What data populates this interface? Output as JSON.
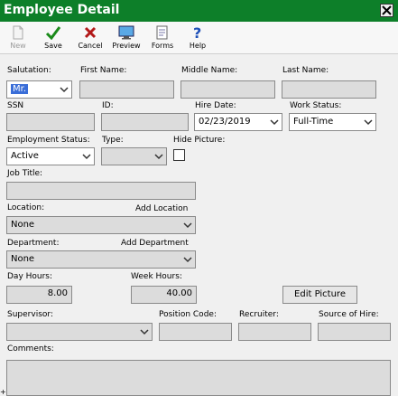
{
  "window": {
    "title": "Employee Detail",
    "close_label": "X"
  },
  "toolbar": {
    "new_label": "New",
    "save_label": "Save",
    "cancel_label": "Cancel",
    "preview_label": "Preview",
    "forms_label": "Forms",
    "help_label": "Help"
  },
  "labels": {
    "salutation": "Salutation:",
    "first_name": "First Name:",
    "middle_name": "Middle Name:",
    "last_name": "Last Name:",
    "ssn": "SSN",
    "id": "ID:",
    "hire_date": "Hire Date:",
    "work_status": "Work Status:",
    "employment_status": "Employment Status:",
    "type": "Type:",
    "hide_picture": "Hide Picture:",
    "job_title": "Job Title:",
    "location": "Location:",
    "add_location": "Add Location",
    "department": "Department:",
    "add_department": "Add Department",
    "day_hours": "Day Hours:",
    "week_hours": "Week Hours:",
    "supervisor": "Supervisor:",
    "position_code": "Position Code:",
    "recruiter": "Recruiter:",
    "source_of_hire": "Source of Hire:",
    "comments": "Comments:"
  },
  "fields": {
    "salutation": "Mr.",
    "first_name": "",
    "middle_name": "",
    "last_name": "",
    "ssn": "",
    "id": "",
    "hire_date": "02/23/2019",
    "work_status": "Full-Time",
    "employment_status": "Active",
    "type": "",
    "hide_picture": false,
    "job_title": "",
    "location": "None",
    "department": "None",
    "day_hours": "8.00",
    "week_hours": "40.00",
    "supervisor": "",
    "position_code": "",
    "recruiter": "",
    "source_of_hire": "",
    "comments": ""
  },
  "buttons": {
    "edit_picture": "Edit Picture"
  },
  "bottom_mark": "+",
  "colors": {
    "titlebar": "#0d7f29",
    "field_bg": "#dcdcdc",
    "selection": "#3a6ed8"
  },
  "icons": {
    "new": "new-doc-icon",
    "save": "checkmark-icon",
    "cancel": "x-icon",
    "preview": "monitor-icon",
    "forms": "forms-icon",
    "help": "question-mark-icon",
    "dropdown": "chevron-down-icon"
  }
}
